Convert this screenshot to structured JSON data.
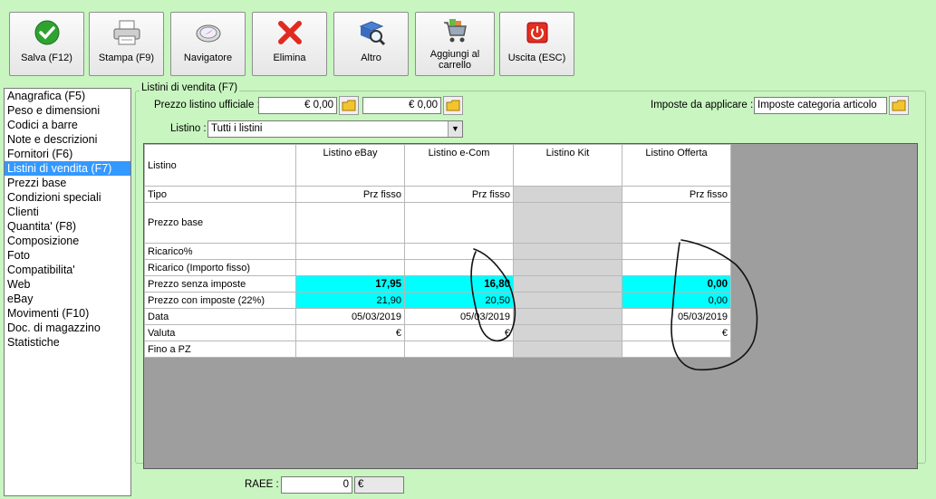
{
  "toolbar": {
    "buttons": [
      {
        "label": "Salva (F12)",
        "icon": "check-icon"
      },
      {
        "label": "Stampa (F9)",
        "icon": "printer-icon"
      },
      {
        "label": "Navigatore",
        "icon": "compass-icon"
      },
      {
        "label": "Elimina",
        "icon": "delete-x-icon"
      },
      {
        "label": "Altro",
        "icon": "search-book-icon"
      },
      {
        "label": "Aggiungi al carrello",
        "icon": "cart-icon"
      },
      {
        "label": "Uscita (ESC)",
        "icon": "power-icon"
      }
    ]
  },
  "sidebar": {
    "items": [
      {
        "label": "Anagrafica (F5)"
      },
      {
        "label": "Peso e dimensioni"
      },
      {
        "label": "Codici a barre"
      },
      {
        "label": "Note e descrizioni"
      },
      {
        "label": "Fornitori (F6)"
      },
      {
        "label": "Listini di vendita (F7)",
        "selected": true
      },
      {
        "label": "Prezzi base"
      },
      {
        "label": "Condizioni speciali"
      },
      {
        "label": "Clienti"
      },
      {
        "label": "Quantita' (F8)"
      },
      {
        "label": "Composizione"
      },
      {
        "label": "Foto"
      },
      {
        "label": "Compatibilita'"
      },
      {
        "label": "Web"
      },
      {
        "label": "eBay"
      },
      {
        "label": "Movimenti (F10)"
      },
      {
        "label": "Doc. di magazzino"
      },
      {
        "label": "Statistiche"
      }
    ]
  },
  "panel": {
    "group_title": "Listini di vendita (F7)",
    "prezzo_ufficiale_label": "Prezzo listino ufficiale :",
    "prezzo_ufficiale_1": "€ 0,00",
    "prezzo_ufficiale_2": "€ 0,00",
    "imposte_label": "Imposte da applicare :",
    "imposte_value": "Imposte categoria articolo",
    "listino_label": "Listino :",
    "listino_value": "Tutti i listini",
    "raee_label": "RAEE :",
    "raee_value": "0",
    "raee_currency": "€"
  },
  "table": {
    "corner_header": "Listino",
    "columns": [
      "Listino eBay",
      "Listino e-Com",
      "Listino Kit",
      "Listino Offerta"
    ],
    "rows": [
      {
        "label": "Tipo",
        "values": [
          "Prz fisso",
          "Prz fisso",
          "",
          "Prz fisso"
        ]
      },
      {
        "label": "Prezzo base",
        "values": [
          "",
          "",
          "",
          ""
        ]
      },
      {
        "label": "Ricarico%",
        "values": [
          "",
          "",
          "",
          ""
        ]
      },
      {
        "label": "Ricarico (Importo fisso)",
        "values": [
          "",
          "",
          "",
          ""
        ]
      },
      {
        "label": "Prezzo senza imposte",
        "values": [
          "17,95",
          "16,80",
          "",
          "0,00"
        ]
      },
      {
        "label": "Prezzo con imposte (22%)",
        "values": [
          "21,90",
          "20,50",
          "",
          "0,00"
        ]
      },
      {
        "label": "Data",
        "values": [
          "05/03/2019",
          "05/03/2019",
          "",
          "05/03/2019"
        ]
      },
      {
        "label": "Valuta",
        "values": [
          "€",
          "€",
          "",
          "€"
        ]
      },
      {
        "label": "Fino a PZ",
        "values": [
          "",
          "",
          "",
          ""
        ]
      }
    ]
  },
  "colors": {
    "background": "#c8f5c0",
    "selection": "#3399ff",
    "highlight_cyan": "#00ffff",
    "disabled_column": "#d4d4d4",
    "grid_background": "#9e9e9e"
  }
}
